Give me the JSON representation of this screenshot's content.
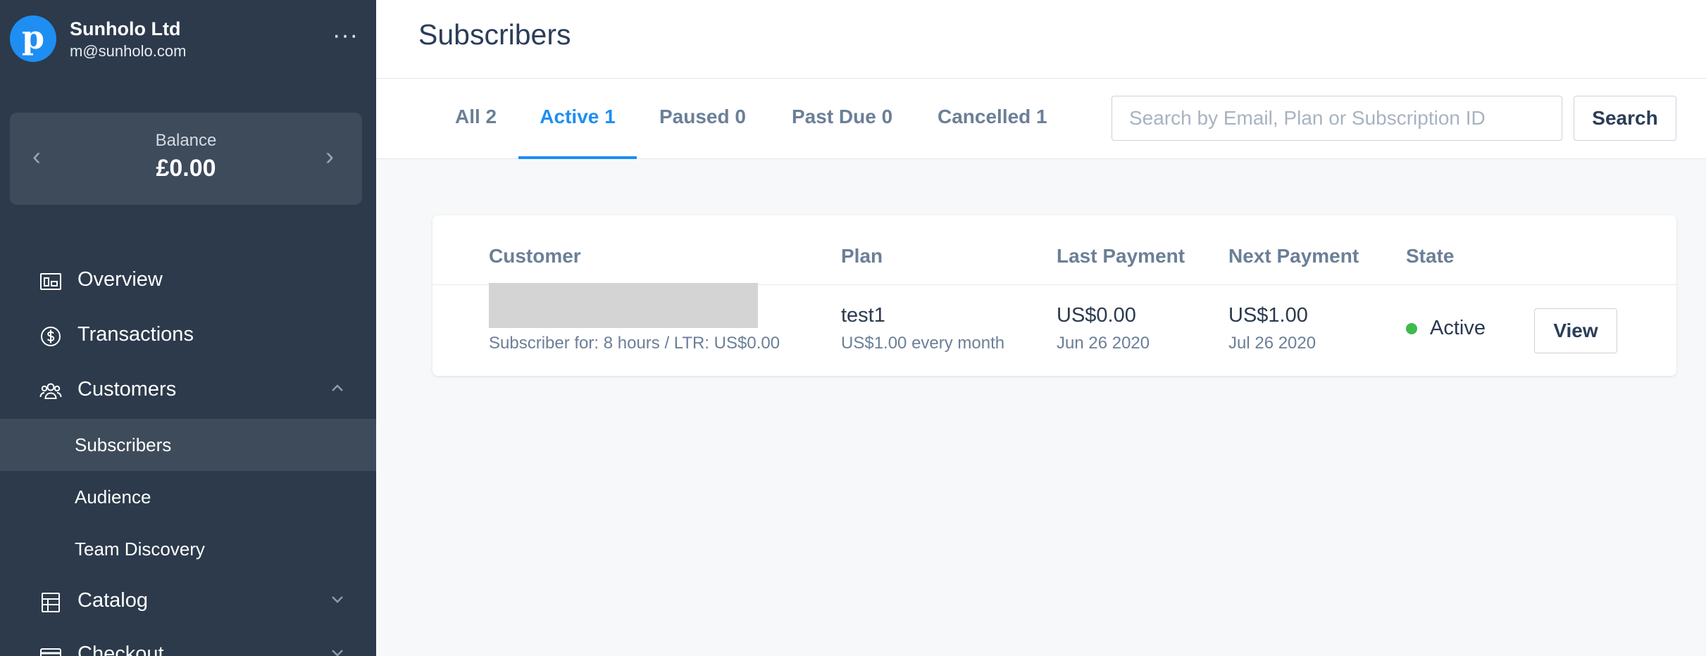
{
  "account": {
    "logo_letter": "p",
    "name": "Sunholo Ltd",
    "email": "m@sunholo.com",
    "more_label": "···"
  },
  "balance": {
    "label": "Balance",
    "value": "£0.00",
    "prev_icon": "‹",
    "next_icon": "›"
  },
  "nav": {
    "overview": "Overview",
    "transactions": "Transactions",
    "customers": "Customers",
    "catalog": "Catalog",
    "checkout": "Checkout",
    "sub_items": {
      "subscribers": "Subscribers",
      "audience": "Audience",
      "team_discovery": "Team Discovery"
    }
  },
  "header": {
    "title": "Subscribers"
  },
  "tabs": {
    "all": "All 2",
    "active": "Active 1",
    "paused": "Paused 0",
    "past_due": "Past Due 0",
    "cancelled": "Cancelled 1"
  },
  "search": {
    "placeholder": "Search by Email, Plan or Subscription ID",
    "button_label": "Search"
  },
  "table": {
    "columns": {
      "customer": "Customer",
      "plan": "Plan",
      "last_payment": "Last Payment",
      "next_payment": "Next Payment",
      "state": "State"
    },
    "rows": [
      {
        "customer_meta": "Subscriber for: 8 hours / LTR: US$0.00",
        "plan_name": "test1",
        "plan_detail": "US$1.00 every month",
        "last_amount": "US$0.00",
        "last_date": "Jun 26 2020",
        "next_amount": "US$1.00",
        "next_date": "Jul 26 2020",
        "state": "Active",
        "action_label": "View"
      }
    ]
  },
  "colors": {
    "sidebar_bg": "#2c3a4b",
    "accent": "#1e8ef3",
    "active_status": "#3dbb4d"
  }
}
